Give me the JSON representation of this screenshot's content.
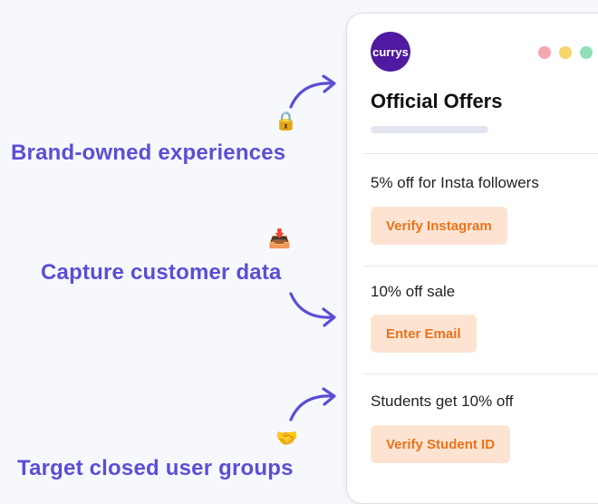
{
  "callouts": {
    "brand": "Brand-owned experiences",
    "capture": "Capture customer data",
    "target": "Target closed user groups"
  },
  "emojis": {
    "lock": "🔒",
    "inbox": "📥",
    "handshake": "🤝"
  },
  "card": {
    "logo_text": "currys",
    "title": "Official Offers",
    "window_dots": [
      "#f4a7ad",
      "#f7d56b",
      "#8fe0b6"
    ],
    "offers": [
      {
        "text": "5% off for Insta followers",
        "button": "Verify Instagram"
      },
      {
        "text": "10% off sale",
        "button": "Enter Email"
      },
      {
        "text": "Students get 10% off",
        "button": "Verify Student ID"
      }
    ]
  },
  "colors": {
    "accent": "#5a4fd6",
    "button_bg": "#fde4d2",
    "button_text": "#e8731c",
    "logo_bg": "#4f1aa0"
  }
}
